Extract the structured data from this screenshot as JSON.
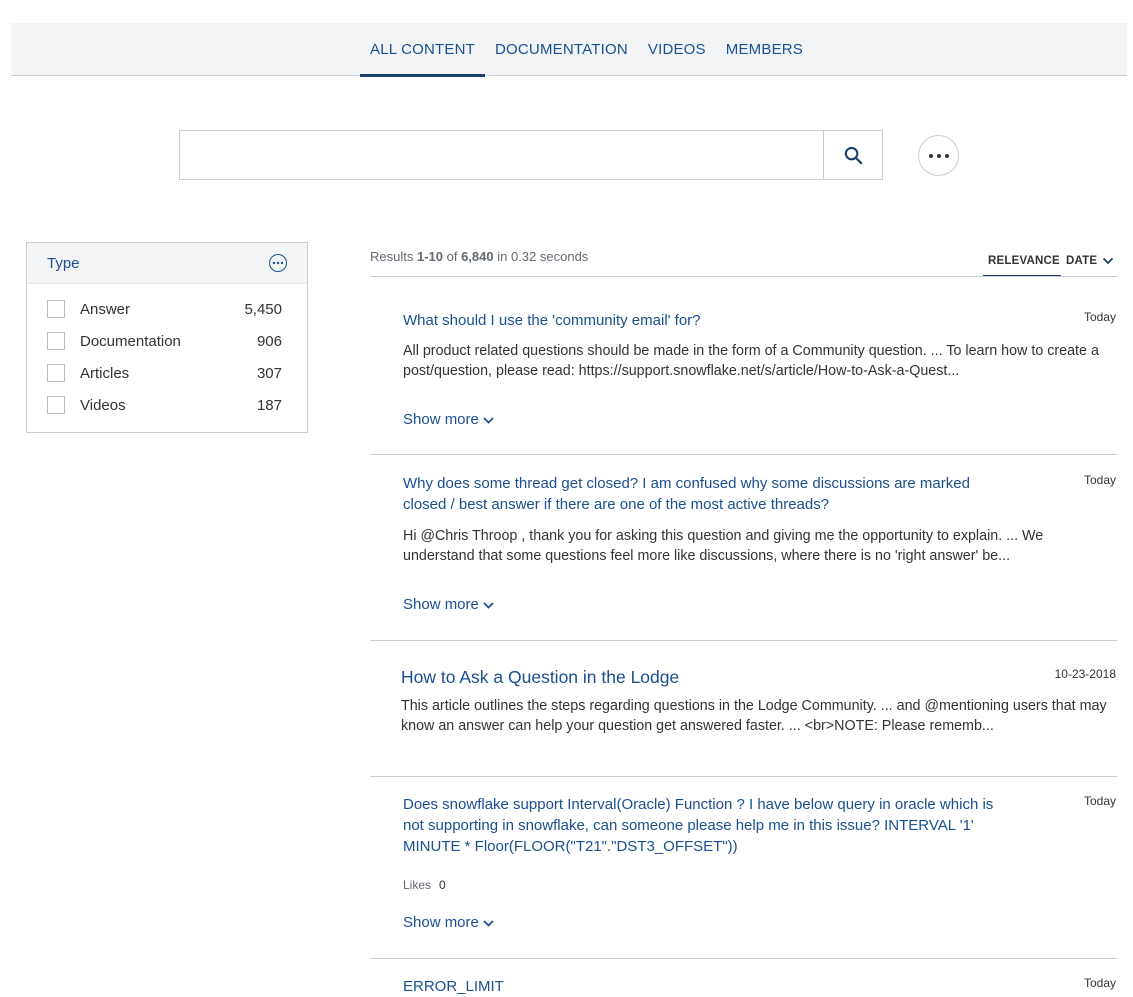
{
  "tabs": [
    {
      "label": "ALL CONTENT",
      "active": true
    },
    {
      "label": "DOCUMENTATION",
      "active": false
    },
    {
      "label": "VIDEOS",
      "active": false
    },
    {
      "label": "MEMBERS",
      "active": false
    }
  ],
  "search": {
    "placeholder": "",
    "value": "",
    "button_icon": "search-icon",
    "more_icon": "more-horizontal-icon"
  },
  "facet": {
    "title": "Type",
    "more_icon": "more-circle-icon",
    "items": [
      {
        "label": "Answer",
        "count": "5,450"
      },
      {
        "label": "Documentation",
        "count": "906"
      },
      {
        "label": "Articles",
        "count": "307"
      },
      {
        "label": "Videos",
        "count": "187"
      }
    ]
  },
  "summary": {
    "prefix": "Results ",
    "range": "1-10",
    "of": " of ",
    "total": "6,840",
    "time_text": " in 0.32 seconds"
  },
  "sort": {
    "relevance": "RELEVANCE",
    "date": "DATE"
  },
  "results": [
    {
      "title": "What should I use the 'community email' for?",
      "date": "Today",
      "excerpt": "All product related questions should be made in the form of a Community question. ... To learn how to create a post/question, please read: https://support.snowflake.net/s/article/How-to-Ask-a-Quest...",
      "show_more": "Show more"
    },
    {
      "title": "Why does some thread get closed? I am confused why some discussions are marked closed / best answer if there are one of the most active threads?",
      "date": "Today",
      "excerpt": "Hi @Chris Throop , thank you for asking this question and giving me the opportunity to explain. ... We understand that some questions feel more like discussions, where there is no 'right answer' be...",
      "show_more": "Show more"
    },
    {
      "title": "How to Ask a Question in the Lodge",
      "date": "10-23-2018",
      "excerpt": "This article outlines the steps regarding questions in the Lodge Community. ... and @mentioning users that may know an answer can help your question get answered faster. ... <br>NOTE: Please rememb..."
    },
    {
      "title": "Does snowflake support Interval(Oracle) Function ? I have below query in oracle which is not supporting in snowflake, can someone please help me in this issue? INTERVAL '1' MINUTE * Floor(FLOOR(\"T21\".\"DST3_OFFSET\"))",
      "date": "Today",
      "likes_label": "Likes",
      "likes_value": "0",
      "show_more": "Show more"
    },
    {
      "title": "ERROR_LIMIT",
      "date": "Today"
    }
  ]
}
